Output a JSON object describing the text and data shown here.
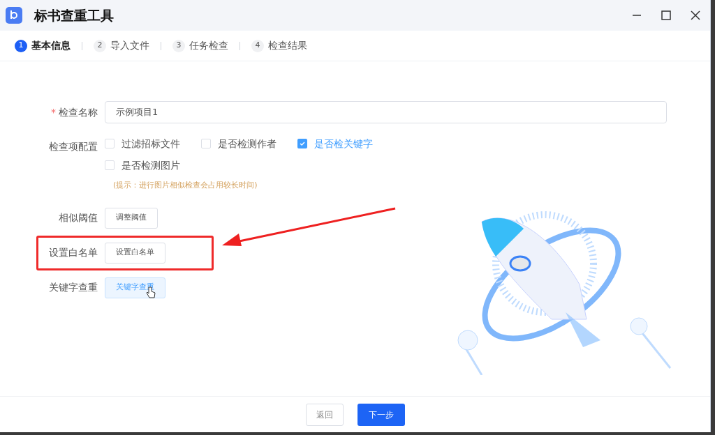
{
  "window": {
    "title": "标书查重工具"
  },
  "steps": [
    {
      "number": "1",
      "label": "基本信息",
      "selected": true
    },
    {
      "number": "2",
      "label": "导入文件",
      "selected": false
    },
    {
      "number": "3",
      "label": "任务检查",
      "selected": false
    },
    {
      "number": "4",
      "label": "检查结果",
      "selected": false
    }
  ],
  "form": {
    "name_field": {
      "label": "检查名称",
      "required_mark": "*",
      "value": "示例项目1"
    },
    "options": {
      "label": "检查项配置",
      "items": [
        {
          "label": "过滤招标文件",
          "checked": false
        },
        {
          "label": "是否检测作者",
          "checked": false
        },
        {
          "label": "是否检关键字",
          "checked": true
        },
        {
          "label": "是否检测图片",
          "checked": false
        }
      ],
      "hint": "(提示：进行图片相似检查会占用较长时间)"
    },
    "rows": [
      {
        "label": "相似阈值",
        "button": "调整阈值",
        "highlighted": false,
        "hovered": false
      },
      {
        "label": "设置白名单",
        "button": "设置白名单",
        "highlighted": true,
        "hovered": false
      },
      {
        "label": "关键字查重",
        "button": "关键字查重",
        "highlighted": false,
        "hovered": true
      }
    ]
  },
  "footer": {
    "buttons": [
      {
        "label": "返回",
        "kind": "secondary"
      },
      {
        "label": "下一步",
        "kind": "primary"
      }
    ]
  }
}
